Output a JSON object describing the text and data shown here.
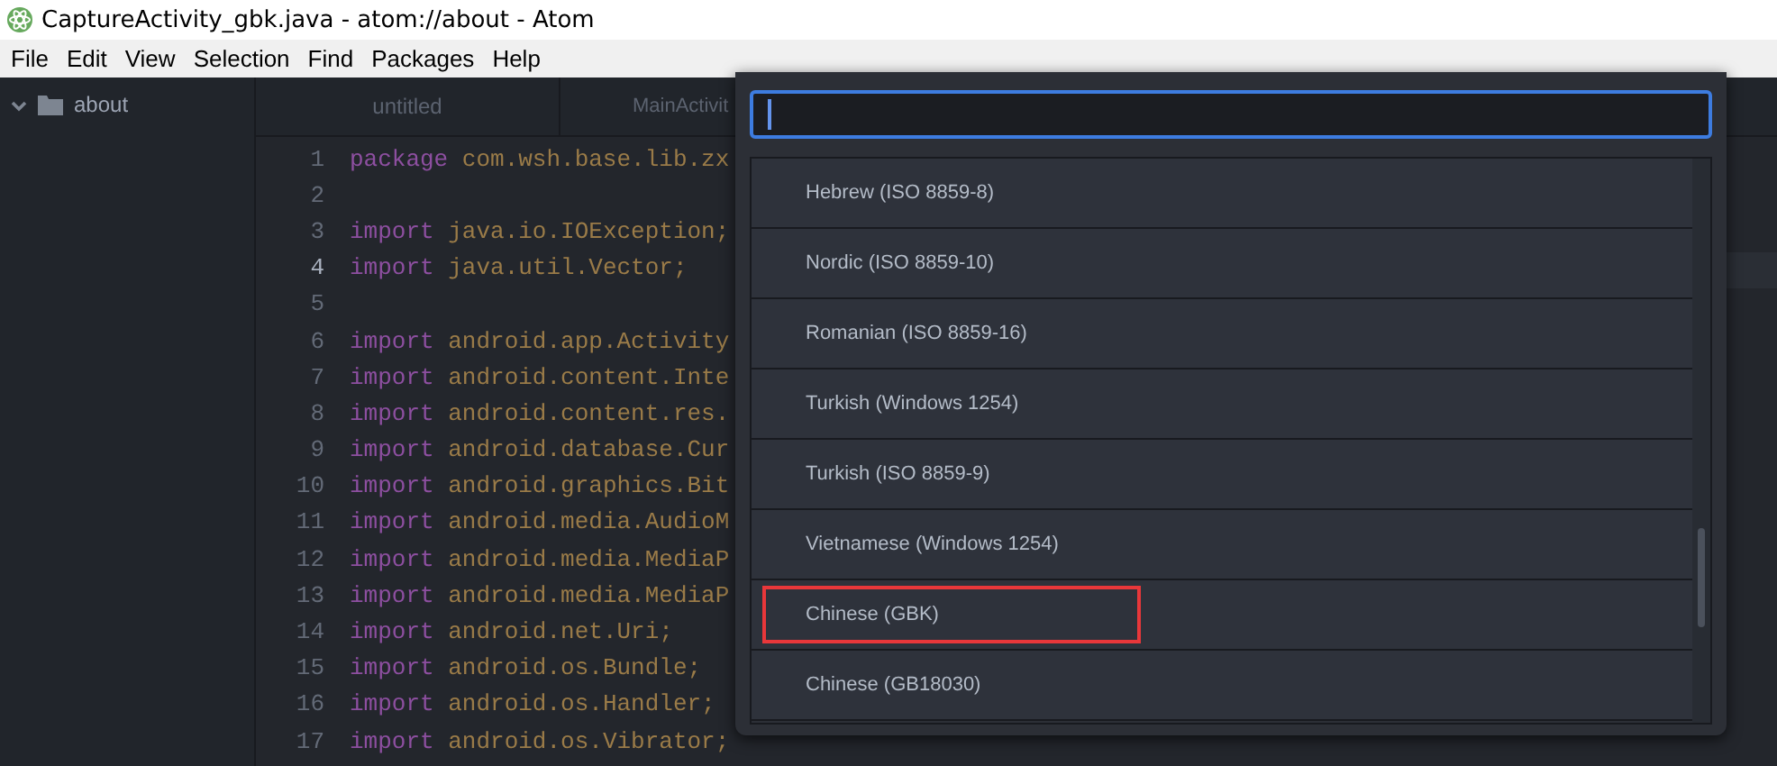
{
  "window": {
    "title": "CaptureActivity_gbk.java - atom://about - Atom"
  },
  "menu": [
    "File",
    "Edit",
    "View",
    "Selection",
    "Find",
    "Packages",
    "Help"
  ],
  "tree_view": {
    "items": [
      {
        "label": "about",
        "expanded": true
      }
    ]
  },
  "tabs": [
    {
      "label": "untitled",
      "selected": false
    },
    {
      "label": "MainActivit",
      "selected": false
    }
  ],
  "editor": {
    "lines": [
      {
        "number": "1",
        "keyword": "package",
        "rest": "com.wsh.base.lib.zx",
        "current": false
      },
      {
        "number": "2",
        "current": false
      },
      {
        "number": "3",
        "keyword": "import",
        "rest": "java.io.IOException;",
        "current": false
      },
      {
        "number": "4",
        "keyword": "import",
        "rest": "java.util.Vector;",
        "current": true
      },
      {
        "number": "5",
        "current": false
      },
      {
        "number": "6",
        "keyword": "import",
        "rest": "android.app.Activity",
        "current": false
      },
      {
        "number": "7",
        "keyword": "import",
        "rest": "android.content.Inte",
        "current": false
      },
      {
        "number": "8",
        "keyword": "import",
        "rest": "android.content.res.",
        "current": false
      },
      {
        "number": "9",
        "keyword": "import",
        "rest": "android.database.Cur",
        "current": false
      },
      {
        "number": "10",
        "keyword": "import",
        "rest": "android.graphics.Bit",
        "current": false
      },
      {
        "number": "11",
        "keyword": "import",
        "rest": "android.media.AudioM",
        "current": false
      },
      {
        "number": "12",
        "keyword": "import",
        "rest": "android.media.MediaP",
        "current": false
      },
      {
        "number": "13",
        "keyword": "import",
        "rest": "android.media.MediaP",
        "current": false
      },
      {
        "number": "14",
        "keyword": "import",
        "rest": "android.net.Uri;",
        "current": false
      },
      {
        "number": "15",
        "keyword": "import",
        "rest": "android.os.Bundle;",
        "current": false
      },
      {
        "number": "16",
        "keyword": "import",
        "rest": "android.os.Handler;",
        "current": false
      },
      {
        "number": "17",
        "keyword": "import",
        "rest": "android.os.Vibrator;",
        "current": false
      }
    ]
  },
  "encoding_selector": {
    "search": {
      "focused": true
    },
    "items": [
      {
        "label": "Hebrew (ISO 8859-8)",
        "highlighted": false
      },
      {
        "label": "Nordic (ISO 8859-10)",
        "highlighted": false
      },
      {
        "label": "Romanian (ISO 8859-16)",
        "highlighted": false
      },
      {
        "label": "Turkish (Windows 1254)",
        "highlighted": false
      },
      {
        "label": "Turkish (ISO 8859-9)",
        "highlighted": false
      },
      {
        "label": "Vietnamese (Windows 1254)",
        "highlighted": false
      },
      {
        "label": "Chinese (GBK)",
        "highlighted": true
      },
      {
        "label": "Chinese (GB18030)",
        "highlighted": false
      }
    ]
  }
}
